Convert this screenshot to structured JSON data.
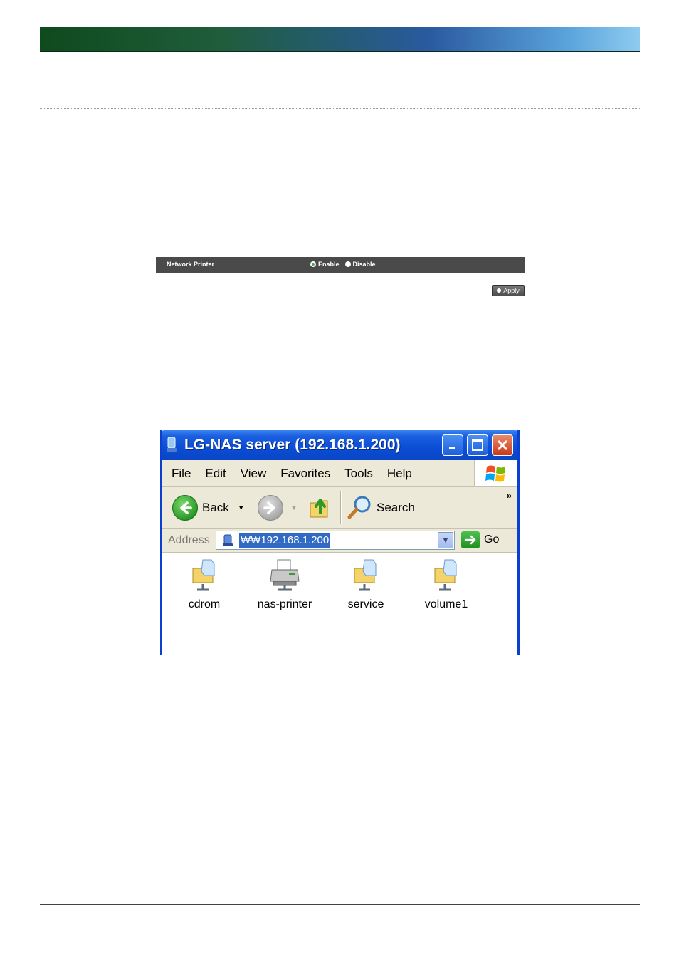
{
  "network_printer": {
    "label": "Network Printer",
    "options": [
      "Enable",
      "Disable"
    ],
    "selected": "Enable",
    "apply_label": "Apply"
  },
  "window": {
    "title": "LG-NAS server (192.168.1.200)",
    "menu": [
      "File",
      "Edit",
      "View",
      "Favorites",
      "Tools",
      "Help"
    ],
    "toolbar": {
      "back_label": "Back",
      "search_label": "Search",
      "more": "»"
    },
    "address": {
      "label": "Address",
      "value": "₩₩192.168.1.200",
      "go_label": "Go"
    },
    "items": [
      {
        "name": "cdrom",
        "icon": "shared-folder-icon"
      },
      {
        "name": "nas-printer",
        "icon": "printer-icon"
      },
      {
        "name": "service",
        "icon": "shared-folder-icon"
      },
      {
        "name": "volume1",
        "icon": "shared-folder-icon"
      }
    ]
  },
  "colors": {
    "xp_blue": "#0a4dd6",
    "xp_toolbar": "#ece9d8",
    "settings_bar": "#4a4a4a",
    "selection": "#316ac5"
  }
}
